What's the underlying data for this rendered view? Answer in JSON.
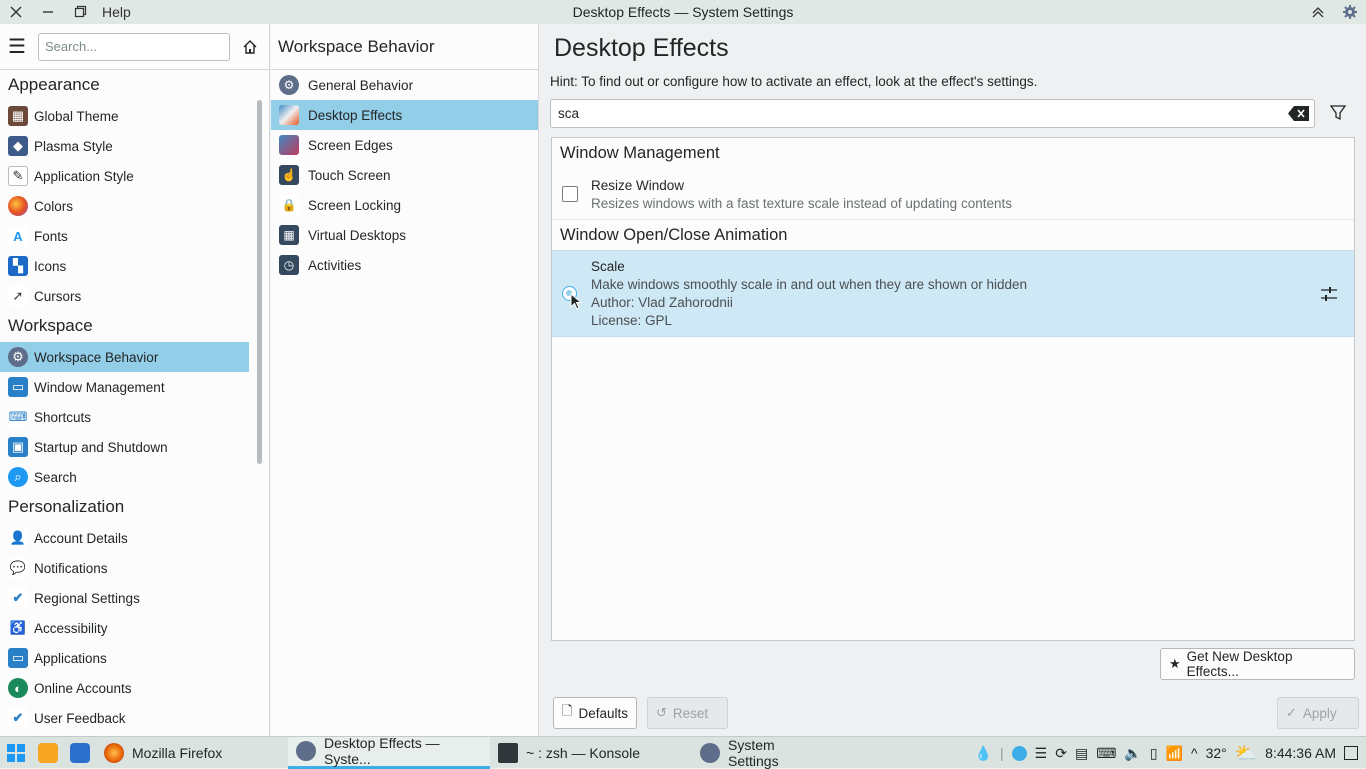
{
  "window": {
    "title": "Desktop Effects — System Settings",
    "help_menu": "Help"
  },
  "sidebar": {
    "search_placeholder": "Search...",
    "categories": [
      {
        "label": "Appearance",
        "items": [
          {
            "label": "Global Theme",
            "icon": "global-theme-icon"
          },
          {
            "label": "Plasma Style",
            "icon": "plasma-style-icon"
          },
          {
            "label": "Application Style",
            "icon": "application-style-icon"
          },
          {
            "label": "Colors",
            "icon": "colors-icon"
          },
          {
            "label": "Fonts",
            "icon": "fonts-icon"
          },
          {
            "label": "Icons",
            "icon": "icons-icon"
          },
          {
            "label": "Cursors",
            "icon": "cursors-icon"
          }
        ]
      },
      {
        "label": "Workspace",
        "items": [
          {
            "label": "Workspace Behavior",
            "icon": "workspace-behavior-icon",
            "selected": true
          },
          {
            "label": "Window Management",
            "icon": "window-management-icon"
          },
          {
            "label": "Shortcuts",
            "icon": "shortcuts-icon"
          },
          {
            "label": "Startup and Shutdown",
            "icon": "startup-shutdown-icon"
          },
          {
            "label": "Search",
            "icon": "search-icon"
          }
        ]
      },
      {
        "label": "Personalization",
        "items": [
          {
            "label": "Account Details",
            "icon": "account-details-icon"
          },
          {
            "label": "Notifications",
            "icon": "notifications-icon"
          },
          {
            "label": "Regional Settings",
            "icon": "regional-settings-icon"
          },
          {
            "label": "Accessibility",
            "icon": "accessibility-icon"
          },
          {
            "label": "Applications",
            "icon": "applications-icon"
          },
          {
            "label": "Online Accounts",
            "icon": "online-accounts-icon"
          },
          {
            "label": "User Feedback",
            "icon": "user-feedback-icon"
          }
        ]
      }
    ]
  },
  "middle": {
    "title": "Workspace Behavior",
    "items": [
      {
        "label": "General Behavior",
        "icon": "general-behavior-icon"
      },
      {
        "label": "Desktop Effects",
        "icon": "desktop-effects-icon",
        "selected": true
      },
      {
        "label": "Screen Edges",
        "icon": "screen-edges-icon"
      },
      {
        "label": "Touch Screen",
        "icon": "touch-screen-icon"
      },
      {
        "label": "Screen Locking",
        "icon": "lock-icon"
      },
      {
        "label": "Virtual Desktops",
        "icon": "virtual-desktops-icon"
      },
      {
        "label": "Activities",
        "icon": "activities-icon"
      }
    ]
  },
  "main": {
    "title": "Desktop Effects",
    "hint": "Hint: To find out or configure how to activate an effect, look at the effect's settings.",
    "filter_value": "sca",
    "groups": [
      {
        "label": "Window Management",
        "effects": [
          {
            "name": "Resize Window",
            "description": "Resizes windows with a fast texture scale instead of updating contents",
            "control": "checkbox",
            "checked": false
          }
        ]
      },
      {
        "label": "Window Open/Close Animation",
        "effects": [
          {
            "name": "Scale",
            "description": "Make windows smoothly scale in and out when they are shown or hidden",
            "author": "Author: Vlad Zahorodnii",
            "license": "License: GPL",
            "control": "radio",
            "highlighted": true
          }
        ]
      }
    ],
    "get_new_label": "Get New Desktop Effects...",
    "defaults_label": "Defaults",
    "reset_label": "Reset",
    "apply_label": "Apply"
  },
  "taskbar": {
    "tasks": [
      {
        "label": "Mozilla Firefox"
      },
      {
        "label": "Desktop Effects — Syste...",
        "active": true
      },
      {
        "label": "~ : zsh — Konsole"
      },
      {
        "label": "System Settings"
      }
    ],
    "temperature": "32°",
    "clock": "8:44:36 AM"
  },
  "colors": {
    "accent": "#3daee9",
    "selection": "#93cee9",
    "highlight_row": "#cfe8f6"
  }
}
